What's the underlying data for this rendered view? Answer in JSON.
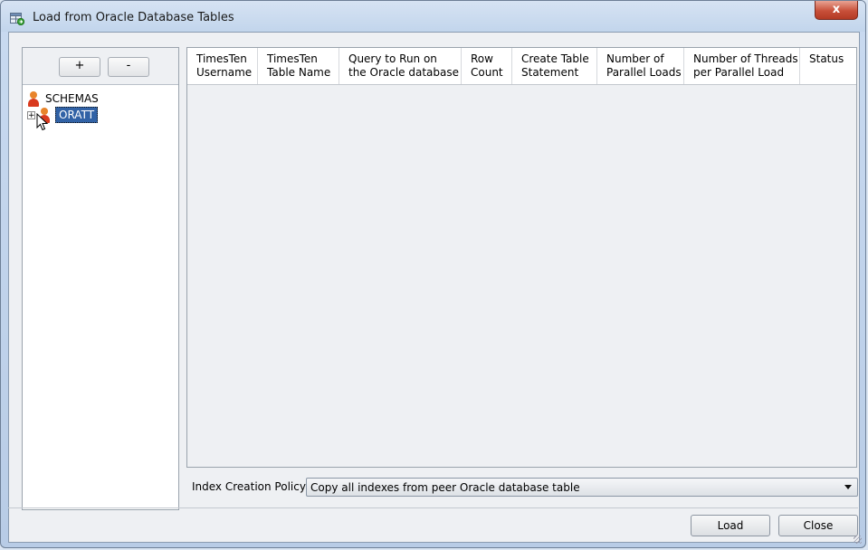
{
  "window": {
    "title": "Load from Oracle Database Tables",
    "close_label": "x"
  },
  "left_panel": {
    "add_label": "+",
    "remove_label": "-",
    "tree": {
      "root_label": "SCHEMAS",
      "child_label": "ORATT",
      "child_expander": "+"
    }
  },
  "grid": {
    "columns": [
      "TimesTen\nUsername",
      "TimesTen\nTable Name",
      "Query to Run on\nthe Oracle database",
      "Row\nCount",
      "Create Table\nStatement",
      "Number of\nParallel Loads",
      "Number of Threads\nper Parallel Load",
      "Status"
    ],
    "rows": []
  },
  "policy": {
    "label": "Index Creation Policy:",
    "selected": "Copy all indexes from peer Oracle database table"
  },
  "buttons": {
    "load_label": "Load",
    "close_label": "Close"
  },
  "colors": {
    "selection": "#3162a6",
    "close_button": "#c8503a"
  }
}
